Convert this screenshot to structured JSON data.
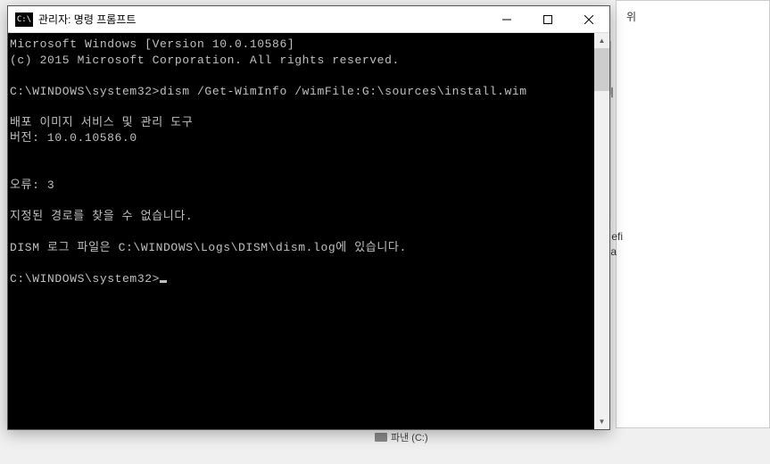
{
  "background": {
    "text1": "위",
    "text2": "이",
    "text3": "efi",
    "text4": "a",
    "bottom_drive": "파낸 (C:)"
  },
  "window": {
    "title": "관리자: 명령 프롬프트",
    "icon_text": "C:\\"
  },
  "terminal": {
    "line1": "Microsoft Windows [Version 10.0.10586]",
    "line2": "(c) 2015 Microsoft Corporation. All rights reserved.",
    "blank1": "",
    "line3": "C:\\WINDOWS\\system32>dism /Get-WimInfo /wimFile:G:\\sources\\install.wim",
    "blank2": "",
    "line4": "배포 이미지 서비스 및 관리 도구",
    "line5": "버전: 10.0.10586.0",
    "blank3": "",
    "blank4": "",
    "line6": "오류: 3",
    "blank5": "",
    "line7": "지정된 경로를 찾을 수 없습니다.",
    "blank6": "",
    "line8": "DISM 로그 파일은 C:\\WINDOWS\\Logs\\DISM\\dism.log에 있습니다.",
    "blank7": "",
    "prompt": "C:\\WINDOWS\\system32>"
  }
}
